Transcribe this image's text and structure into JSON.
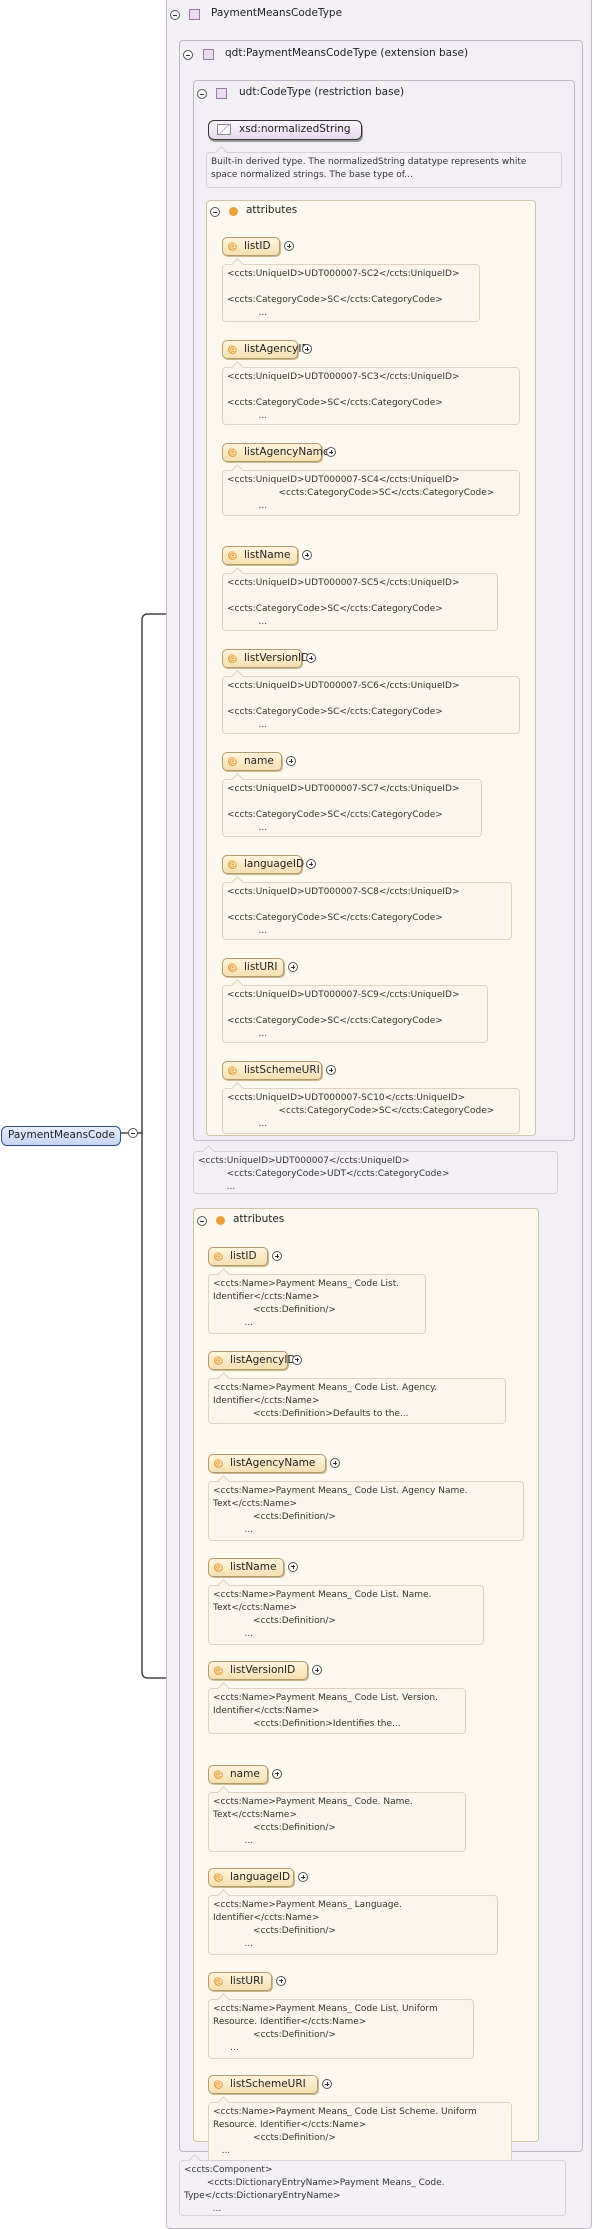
{
  "root": {
    "label": "PaymentMeansCode"
  },
  "type": {
    "title": "PaymentMeansCodeType"
  },
  "qdt": {
    "title": "qdt:PaymentMeansCodeType (extension base)"
  },
  "udt": {
    "title": "udt:CodeType (restriction base)",
    "xsd_label": "xsd:normalizedString",
    "xsd_doc": "Built-in derived type. The normalizedString datatype represents white\nspace normalized strings. The base type of..."
  },
  "udt_attributes": {
    "title": "attributes",
    "items": [
      {
        "label": "listID",
        "doc": "<ccts:UniqueID>UDT000007-SC2</ccts:UniqueID>\n\n<ccts:CategoryCode>SC</ccts:CategoryCode>\n           ..."
      },
      {
        "label": "listAgencyID",
        "doc": "<ccts:UniqueID>UDT000007-SC3</ccts:UniqueID>\n\n<ccts:CategoryCode>SC</ccts:CategoryCode>\n           ..."
      },
      {
        "label": "listAgencyName",
        "doc": "<ccts:UniqueID>UDT000007-SC4</ccts:UniqueID>\n                  <ccts:CategoryCode>SC</ccts:CategoryCode>\n           ..."
      },
      {
        "label": "listName",
        "doc": "<ccts:UniqueID>UDT000007-SC5</ccts:UniqueID>\n\n<ccts:CategoryCode>SC</ccts:CategoryCode>\n           ..."
      },
      {
        "label": "listVersionID",
        "doc": "<ccts:UniqueID>UDT000007-SC6</ccts:UniqueID>\n\n<ccts:CategoryCode>SC</ccts:CategoryCode>\n           ..."
      },
      {
        "label": "name",
        "doc": "<ccts:UniqueID>UDT000007-SC7</ccts:UniqueID>\n\n<ccts:CategoryCode>SC</ccts:CategoryCode>\n           ..."
      },
      {
        "label": "languageID",
        "doc": "<ccts:UniqueID>UDT000007-SC8</ccts:UniqueID>\n\n<ccts:CategoryCode>SC</ccts:CategoryCode>\n           ..."
      },
      {
        "label": "listURI",
        "doc": "<ccts:UniqueID>UDT000007-SC9</ccts:UniqueID>\n\n<ccts:CategoryCode>SC</ccts:CategoryCode>\n           ..."
      },
      {
        "label": "listSchemeURI",
        "doc": "<ccts:UniqueID>UDT000007-SC10</ccts:UniqueID>\n                  <ccts:CategoryCode>SC</ccts:CategoryCode>\n           ..."
      }
    ]
  },
  "qdt_doc": "<ccts:UniqueID>UDT000007</ccts:UniqueID>\n          <ccts:CategoryCode>UDT</ccts:CategoryCode>\n          ...",
  "qdt_attributes": {
    "title": "attributes",
    "items": [
      {
        "label": "listID",
        "doc": "<ccts:Name>Payment Means_ Code List.\nIdentifier</ccts:Name>\n              <ccts:Definition/>\n           ..."
      },
      {
        "label": "listAgencyID",
        "doc": "<ccts:Name>Payment Means_ Code List. Agency.\nIdentifier</ccts:Name>\n              <ccts:Definition>Defaults to the..."
      },
      {
        "label": "listAgencyName",
        "doc": "<ccts:Name>Payment Means_ Code List. Agency Name.\nText</ccts:Name>\n              <ccts:Definition/>\n           ..."
      },
      {
        "label": "listName",
        "doc": "<ccts:Name>Payment Means_ Code List. Name.\nText</ccts:Name>\n              <ccts:Definition/>\n           ..."
      },
      {
        "label": "listVersionID",
        "doc": "<ccts:Name>Payment Means_ Code List. Version.\nIdentifier</ccts:Name>\n              <ccts:Definition>Identifies the..."
      },
      {
        "label": "name",
        "doc": "<ccts:Name>Payment Means_ Code. Name.\nText</ccts:Name>\n              <ccts:Definition/>\n           ..."
      },
      {
        "label": "languageID",
        "doc": "<ccts:Name>Payment Means_ Language.\nIdentifier</ccts:Name>\n              <ccts:Definition/>\n           ..."
      },
      {
        "label": "listURI",
        "doc": "<ccts:Name>Payment Means_ Code List. Uniform\nResource. Identifier</ccts:Name>\n              <ccts:Definition/>\n      ..."
      },
      {
        "label": "listSchemeURI",
        "doc": "<ccts:Name>Payment Means_ Code List Scheme. Uniform\nResource. Identifier</ccts:Name>\n              <ccts:Definition/>\n   ..."
      }
    ]
  },
  "type_doc": "<ccts:Component>\n        <ccts:DictionaryEntryName>Payment Means_ Code.\nType</ccts:DictionaryEntryName>\n          ..."
}
